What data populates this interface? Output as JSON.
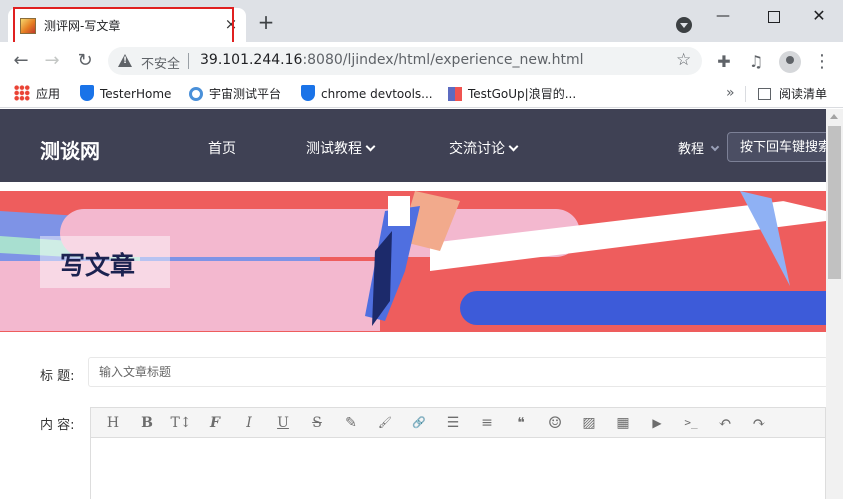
{
  "browser": {
    "tab": {
      "title": "测评网-写文章",
      "close": "×"
    },
    "new_tab": "+",
    "window": {
      "minimize": "—",
      "maximize": "",
      "close": "✕"
    },
    "nav": {
      "back": "←",
      "forward": "→",
      "reload": "↻"
    },
    "address": {
      "security_label": "不安全",
      "host": "39.101.244.16",
      "rest": ":8080/ljindex/html/experience_new.html"
    },
    "icons": {
      "star": "☆",
      "extensions": "✚",
      "media": "♫",
      "menu": "⋮"
    },
    "bookmarks": [
      {
        "label": "应用",
        "icon": "apps-icon"
      },
      {
        "label": "TesterHome",
        "icon": "shield-icon"
      },
      {
        "label": "宇宙测试平台",
        "icon": "gear-icon"
      },
      {
        "label": "chrome devtools...",
        "icon": "shield-icon"
      },
      {
        "label": "TestGoUp|浪冒的...",
        "icon": "testgoup-icon"
      }
    ],
    "bookmarks_more": "»",
    "reading_list": "阅读清单"
  },
  "site": {
    "logo": "测谈网",
    "nav": [
      {
        "label": "首页",
        "dropdown": false
      },
      {
        "label": "测试教程",
        "dropdown": true
      },
      {
        "label": "交流讨论",
        "dropdown": true
      }
    ],
    "search_scope": "教程",
    "search_placeholder": "按下回车键搜索"
  },
  "banner": {
    "title": "写文章"
  },
  "form": {
    "title_label": "标 题:",
    "title_placeholder": "输入文章标题",
    "content_label": "内 容:",
    "toolbar": [
      {
        "name": "heading-icon",
        "glyph": "H"
      },
      {
        "name": "bold-icon",
        "glyph": "B"
      },
      {
        "name": "text-size-icon",
        "glyph": "T↕"
      },
      {
        "name": "font-icon",
        "glyph": "F"
      },
      {
        "name": "italic-icon",
        "glyph": "I"
      },
      {
        "name": "underline-icon",
        "glyph": "U"
      },
      {
        "name": "strikethrough-icon",
        "glyph": "S"
      },
      {
        "name": "highlighter-icon",
        "glyph": "✎"
      },
      {
        "name": "brush-icon",
        "glyph": "🖌"
      },
      {
        "name": "link-icon",
        "glyph": "🔗"
      },
      {
        "name": "list-icon",
        "glyph": "☰"
      },
      {
        "name": "align-icon",
        "glyph": "≡"
      },
      {
        "name": "quote-icon",
        "glyph": "❝"
      },
      {
        "name": "emoji-icon",
        "glyph": "☺"
      },
      {
        "name": "image-icon",
        "glyph": "▨"
      },
      {
        "name": "table-icon",
        "glyph": "▦"
      },
      {
        "name": "video-icon",
        "glyph": "▶"
      },
      {
        "name": "code-icon",
        "glyph": ">_"
      },
      {
        "name": "undo-icon",
        "glyph": "↶"
      },
      {
        "name": "redo-icon",
        "glyph": "↷"
      }
    ]
  },
  "colors": {
    "nav_bg": "#3f4154",
    "banner_red": "#ee5d5d",
    "banner_pink": "#f3b8cf",
    "banner_blue": "#3d5bd9",
    "tab_highlight": "#e02020"
  }
}
